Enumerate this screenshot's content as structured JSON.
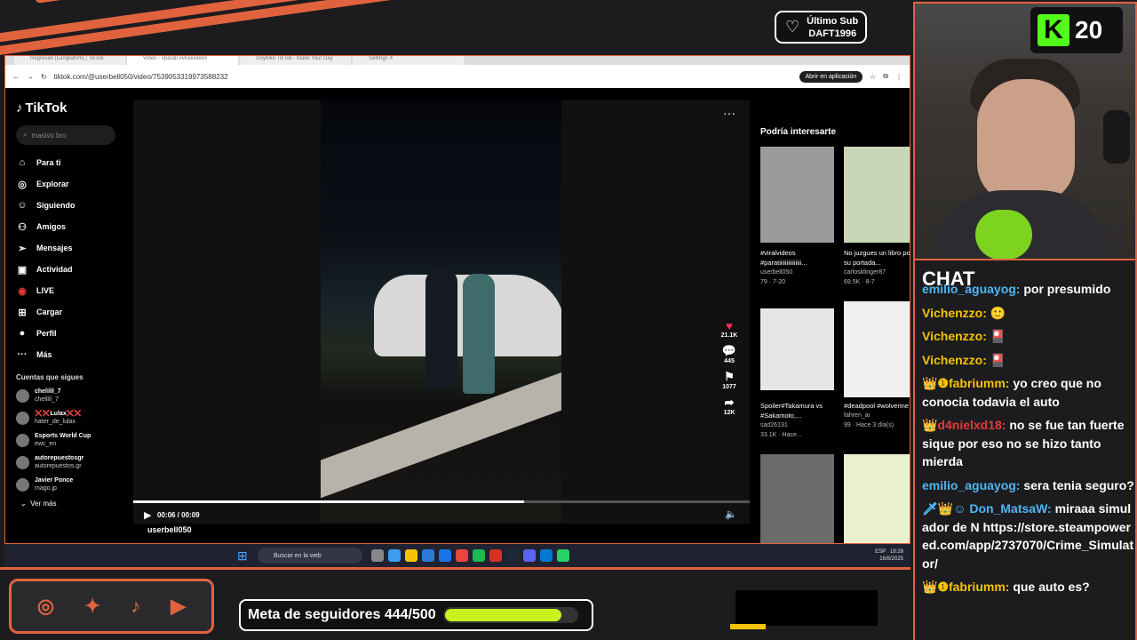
{
  "overlay": {
    "last_sub_label": "Último Sub",
    "last_sub_name": "DAFT1996"
  },
  "browser": {
    "tabs": [
      "Regresan (Lungilahim) | TikTok",
      "Video - #parati #viralvideos",
      "Goyhiko TikTok - Make Your Day",
      "Settings X"
    ],
    "url": "tiktok.com/@userbell050/video/7539053319973588232",
    "open_app": "Abrir en aplicación"
  },
  "tiktok": {
    "logo": "TikTok",
    "search": "masivo bro",
    "nav": [
      "Para ti",
      "Explorar",
      "Siguiendo",
      "Amigos",
      "Mensajes",
      "Actividad",
      "LIVE",
      "Cargar",
      "Perfil",
      "Más"
    ],
    "following_header": "Cuentas que sigues",
    "following": [
      {
        "name": "chelilil_7",
        "handle": "chelilil_7"
      },
      {
        "name": "❌❌Lulax❌❌",
        "handle": "hater_de_lulax"
      },
      {
        "name": "Esports World Cup",
        "handle": "ewc_en"
      },
      {
        "name": "autorepuestosgr",
        "handle": "autorepuestos.gr"
      },
      {
        "name": "Javier Ponce",
        "handle": "mago.jp"
      }
    ],
    "see_more": "Ver más",
    "time": "00:06 / 00:09",
    "author": "userbell050",
    "likes": "21.1K",
    "comments": "445",
    "saves": "1077",
    "shares": "12K",
    "rec_header": "Podría interesarte",
    "recs": [
      {
        "title": "#viralvideos #paratiiiiiiiiiiiiiii...",
        "user": "userbell050",
        "stats": "79 · 7-20"
      },
      {
        "title": "No juzgues un libro por su portada...",
        "user": "carlosklinger87",
        "stats": "69.5K · 8-7"
      },
      {
        "title": "Spoiler#Takamura vs #Sakamoto,...",
        "user": "sad26131",
        "stats": "33.1K · Hace..."
      },
      {
        "title": "#deadpool #wolverine",
        "user": "fahren_ai",
        "stats": "99 · Hace 3 día(s)"
      }
    ]
  },
  "taskbar": {
    "search": "Buscar en la web",
    "lang": "ESP",
    "time": "18:28",
    "date": "16/8/2025"
  },
  "bottom": {
    "goal_label": "Meta de seguidores 444/500",
    "goal_progress": 0.888
  },
  "cam": {
    "kick_count": "20"
  },
  "chat": {
    "title": "CHAT",
    "messages": [
      {
        "user": "emilio_aguayog:",
        "text": "por presumido",
        "color": "#4fb6f2"
      },
      {
        "user": "Vichenzzo:",
        "text": "🙂",
        "color": "#f5c400"
      },
      {
        "user": "Vichenzzo:",
        "text": "🎴",
        "color": "#f5c400"
      },
      {
        "user": "Vichenzzo:",
        "text": "🎴",
        "color": "#f5c400"
      },
      {
        "user": "👑❶fabriumm:",
        "text": "yo creo que no conocia todavia el auto",
        "color": "#f5c400"
      },
      {
        "user": "👑d4nielxd18:",
        "text": "no se fue tan fuerte sique por eso no se hizo tanto mierda",
        "color": "#e63a3a"
      },
      {
        "user": "emilio_aguayog:",
        "text": "sera tenia seguro?",
        "color": "#4fb6f2"
      },
      {
        "user": "🗡👑☺ Don_MatsaW:",
        "text": "miraaa simulador de N https://store.steampowered.com/app/2737070/Crime_Simulator/",
        "color": "#4fb6f2"
      },
      {
        "user": "👑❶fabriumm:",
        "text": "que auto es?",
        "color": "#f5c400"
      }
    ]
  }
}
